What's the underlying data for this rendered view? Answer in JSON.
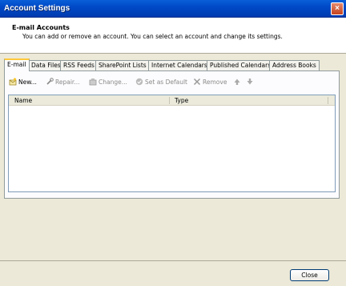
{
  "window": {
    "title": "Account Settings",
    "close_glyph": "×"
  },
  "header": {
    "title": "E-mail Accounts",
    "description": "You can add or remove an account. You can select an account and change its settings."
  },
  "tabs": [
    {
      "label": "E-mail",
      "active": true
    },
    {
      "label": "Data Files"
    },
    {
      "label": "RSS Feeds"
    },
    {
      "label": "SharePoint Lists"
    },
    {
      "label": "Internet Calendars"
    },
    {
      "label": "Published Calendars"
    },
    {
      "label": "Address Books"
    }
  ],
  "toolbar": {
    "new": {
      "label": "New...",
      "icon": "new-account-icon"
    },
    "repair": {
      "label": "Repair...",
      "icon": "repair-icon"
    },
    "change": {
      "label": "Change...",
      "icon": "change-icon"
    },
    "set_default": {
      "label": "Set as Default",
      "icon": "check-icon"
    },
    "remove": {
      "label": "Remove",
      "icon": "remove-icon"
    },
    "move_up": {
      "icon": "arrow-up-icon"
    },
    "move_down": {
      "icon": "arrow-down-icon"
    }
  },
  "list": {
    "columns": [
      {
        "label": "Name"
      },
      {
        "label": "Type"
      }
    ],
    "rows": []
  },
  "footer": {
    "close_label": "Close"
  },
  "colors": {
    "titlebar": "#0049c7",
    "tab_active_accent": "#ffc83c",
    "dialog_bg": "#ece9d8"
  }
}
